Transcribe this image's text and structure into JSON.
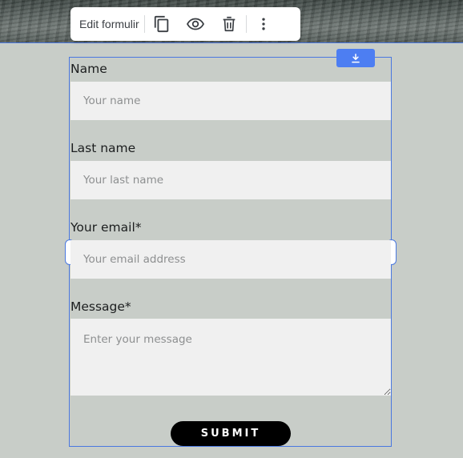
{
  "toolbar": {
    "edit_label": "Edit formulir",
    "icons": [
      "duplicate-icon",
      "preview-eye-icon",
      "trash-icon",
      "more-vertical-icon"
    ]
  },
  "widget": {
    "download_icon": "download-icon"
  },
  "form": {
    "fields": [
      {
        "label": "Name",
        "placeholder": "Your name"
      },
      {
        "label": "Last name",
        "placeholder": "Your last name"
      },
      {
        "label": "Your email*",
        "placeholder": "Your email address"
      },
      {
        "label": "Message*",
        "placeholder": "Enter your message"
      }
    ],
    "submit_label": "SUBMIT"
  },
  "colors": {
    "page_background": "#c8cdc8",
    "selection_accent": "#4a78e0",
    "input_background": "#f0f0f0",
    "submit_background": "#000000"
  }
}
